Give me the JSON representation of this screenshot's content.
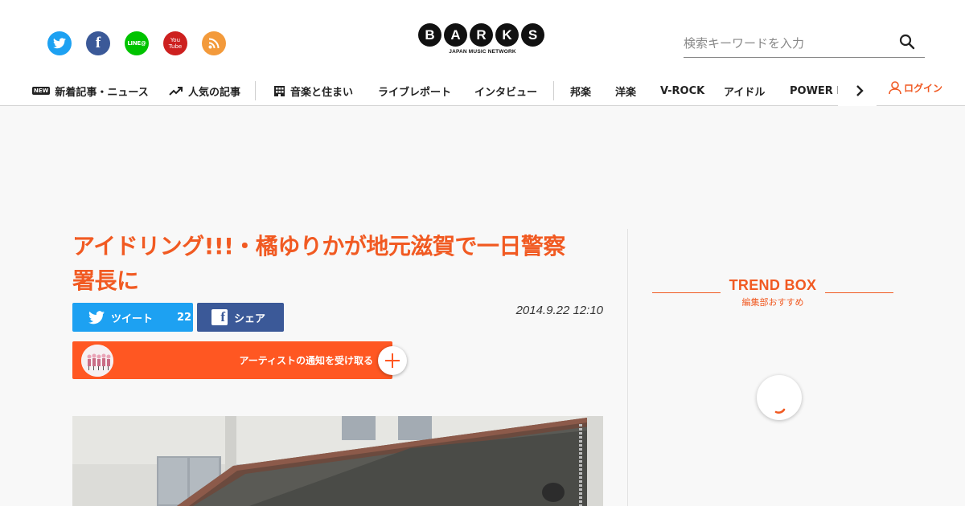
{
  "header": {
    "social": [
      {
        "name": "twitter-icon"
      },
      {
        "name": "facebook-icon",
        "glyph": "f"
      },
      {
        "name": "line-icon",
        "glyph": "LINE@"
      },
      {
        "name": "youtube-icon",
        "glyph": "You Tube"
      },
      {
        "name": "rss-icon"
      }
    ],
    "logo": {
      "letters": [
        "B",
        "A",
        "R",
        "K",
        "S"
      ],
      "subtitle": "JAPAN MUSIC NETWORK"
    },
    "search": {
      "placeholder": "検索キーワードを入力"
    },
    "nav": {
      "new_badge": "NEW",
      "items": [
        "新着記事・ニュース",
        "人気の記事",
        "音楽と住まい",
        "ライブレポート",
        "インタビュー",
        "邦楽",
        "洋楽",
        "V-ROCK",
        "アイドル",
        "POWER PUSH"
      ]
    },
    "login": "ログイン"
  },
  "article": {
    "title_line1": "アイドリング!!!・橘ゆりかが地元滋賀で一日警察",
    "title_line2": "署長に",
    "tweet_label": "ツイート",
    "tweet_count": "22",
    "share_label": "シェア",
    "date": "2014.9.22 12:10",
    "notify_label": "アーティストの通知を受け取る"
  },
  "sidebar": {
    "trend_title": "TREND BOX",
    "trend_sub": "編集部おすすめ"
  },
  "colors": {
    "accent": "#f15a22",
    "notify_bg": "#ff5722",
    "twitter": "#1da1f2",
    "facebook": "#3b5998",
    "line": "#00c300",
    "youtube": "#cd201f",
    "rss": "#f39a3b"
  }
}
